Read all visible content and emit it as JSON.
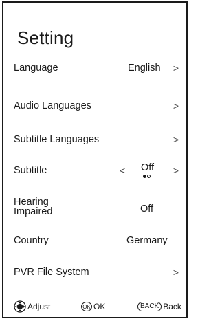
{
  "menu": {
    "title": "Setting",
    "items": [
      {
        "label": "Language",
        "value": "English",
        "right_arrow": ">"
      },
      {
        "label": "Audio Languages",
        "value": "",
        "right_arrow": ">"
      },
      {
        "label": "Subtitle Languages",
        "value": "",
        "right_arrow": ">"
      },
      {
        "label": "Subtitle",
        "value": "Off",
        "left_arrow": "<",
        "right_arrow": ">"
      },
      {
        "label_line1": "Hearing",
        "label_line2": "Impaired",
        "value": "Off"
      },
      {
        "label": "Country",
        "value": "Germany"
      },
      {
        "label": "PVR File System",
        "value": "",
        "right_arrow": ">"
      }
    ]
  },
  "footer": {
    "adjust_label": "Adjust",
    "ok_badge": "OK",
    "ok_label": "OK",
    "back_badge": "BACK",
    "back_label": "Back"
  }
}
